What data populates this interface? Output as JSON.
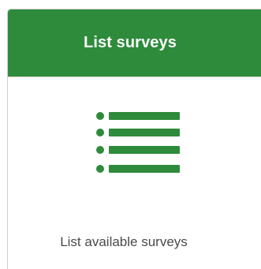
{
  "card": {
    "title": "List surveys",
    "description": "List available surveys",
    "icon": "list-icon",
    "header_color": "#2e8b3b",
    "icon_color": "#2e8b3b"
  }
}
